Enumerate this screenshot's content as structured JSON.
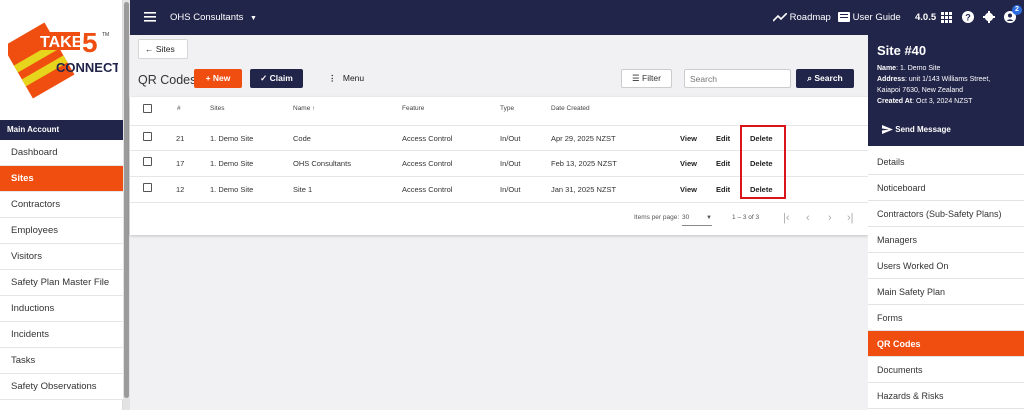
{
  "logo": {
    "brand_line1": "TAKE",
    "brand_number": "5",
    "brand_line2": "CONNECT",
    "tm": "TM"
  },
  "sidebar": {
    "section_label": "Main Account",
    "items": [
      {
        "label": "Dashboard"
      },
      {
        "label": "Sites"
      },
      {
        "label": "Contractors"
      },
      {
        "label": "Employees"
      },
      {
        "label": "Visitors"
      },
      {
        "label": "Safety Plan Master File"
      },
      {
        "label": "Inductions"
      },
      {
        "label": "Incidents"
      },
      {
        "label": "Tasks"
      },
      {
        "label": "Safety Observations"
      }
    ]
  },
  "topbar": {
    "org_name": "OHS Consultants",
    "roadmap_label": "Roadmap",
    "guide_label": "User Guide",
    "version": "4.0.5",
    "notification_count": "2"
  },
  "toolbar": {
    "back_label": "Sites",
    "title": "QR Codes",
    "new_label": "New",
    "claim_label": "Claim",
    "menu_label": "Menu",
    "filter_label": "Filter",
    "search_placeholder": "Search",
    "search_label": "Search"
  },
  "table": {
    "headers": {
      "num": "#",
      "sites": "Sites",
      "name": "Name",
      "feature": "Feature",
      "type": "Type",
      "date": "Date Created"
    },
    "rows": [
      {
        "num": "21",
        "site": "1. Demo Site",
        "name": "Code",
        "feature": "Access Control",
        "type": "In/Out",
        "date": "Apr 29, 2025 NZST",
        "view": "View",
        "edit": "Edit",
        "delete": "Delete"
      },
      {
        "num": "17",
        "site": "1. Demo Site",
        "name": "OHS Consultants",
        "feature": "Access Control",
        "type": "In/Out",
        "date": "Feb 13, 2025 NZST",
        "view": "View",
        "edit": "Edit",
        "delete": "Delete"
      },
      {
        "num": "12",
        "site": "1. Demo Site",
        "name": "Site 1",
        "feature": "Access Control",
        "type": "In/Out",
        "date": "Jan 31, 2025 NZST",
        "view": "View",
        "edit": "Edit",
        "delete": "Delete"
      }
    ],
    "pager": {
      "items_label": "Items per page:",
      "per_page": "30",
      "range": "1 – 3 of 3"
    }
  },
  "site_panel": {
    "title": "Site #40",
    "name_label": "Name",
    "name_value": ": 1. Demo Site",
    "address_label": "Address",
    "address_value": ": unit 1/143 Williams Street, Kaiapoi 7630, New Zealand",
    "created_label": "Created At",
    "created_value": ": Oct 3, 2024 NZST",
    "send_label": "Send Message",
    "nav": [
      {
        "label": "Details"
      },
      {
        "label": "Noticeboard"
      },
      {
        "label": "Contractors (Sub-Safety Plans)"
      },
      {
        "label": "Managers"
      },
      {
        "label": "Users Worked On"
      },
      {
        "label": "Main Safety Plan"
      },
      {
        "label": "Forms"
      },
      {
        "label": "QR Codes"
      },
      {
        "label": "Documents"
      },
      {
        "label": "Hazards & Risks"
      }
    ]
  },
  "colors": {
    "navy": "#22254a",
    "accent": "#f04e10",
    "highlight": "#d9141b"
  }
}
